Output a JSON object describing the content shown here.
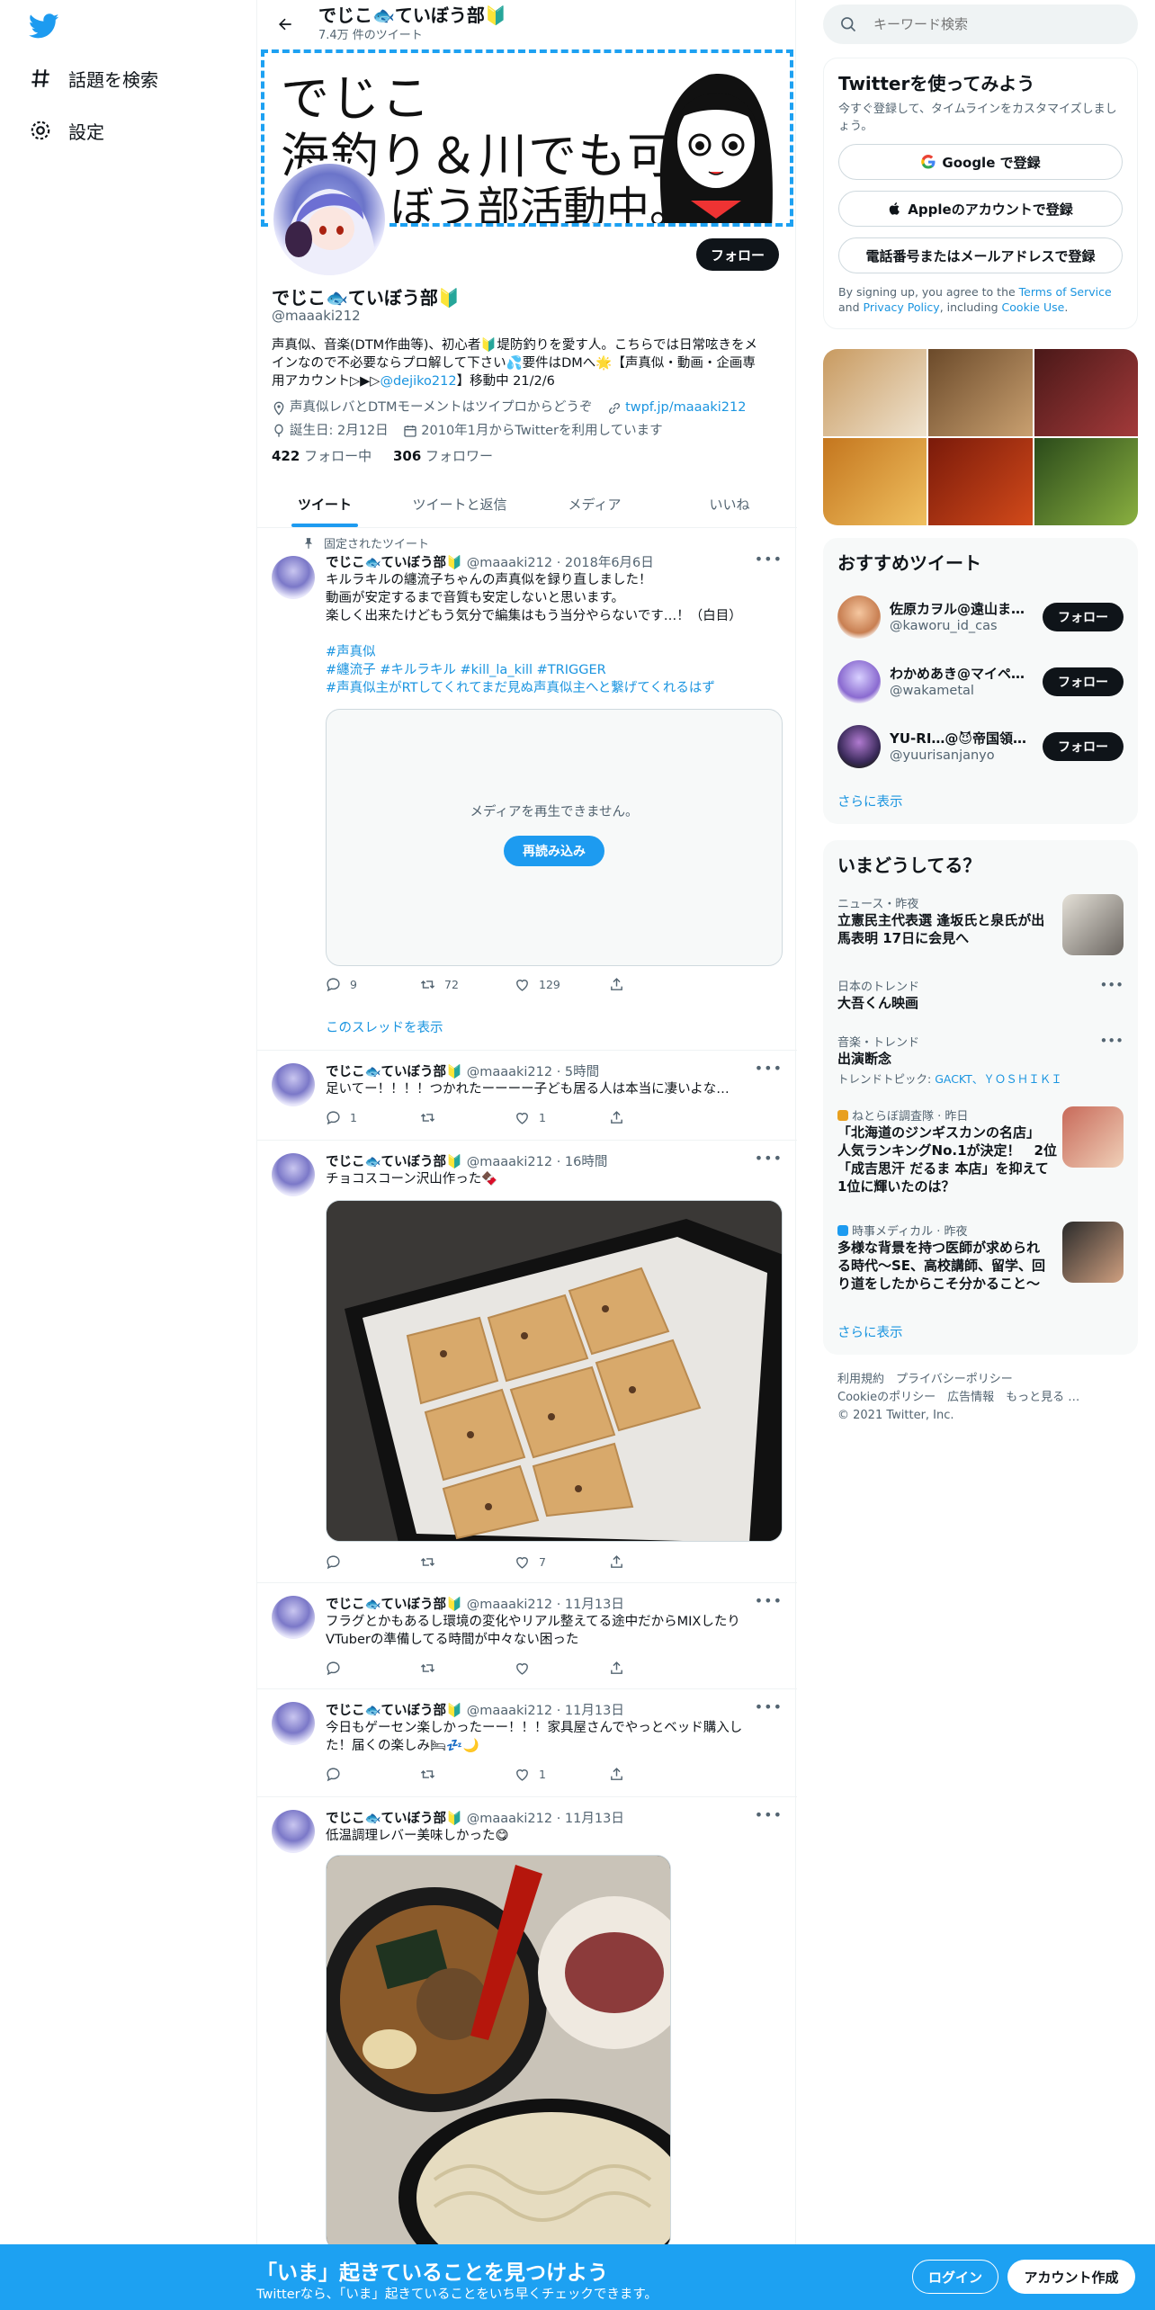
{
  "nav": {
    "explore_label": "話題を検索",
    "settings_label": "設定"
  },
  "header": {
    "name": "でじこ🐟ていぼう部🔰",
    "tweet_count": "7.4万 件のツイート"
  },
  "banner": {
    "line1": "でじこ",
    "line2": "海釣り＆川でも可",
    "line3": "ぼう部活動中。"
  },
  "profile": {
    "follow_label": "フォロー",
    "name": "でじこ🐟ていぼう部🔰",
    "handle": "@maaaki212",
    "bio1": "声真似、音楽(DTM作曲等)、初心者🔰堤防釣りを愛す人。こちらでは日常呟きをメ",
    "bio2": "インなので不必要ならプロ解して下さい💦要件はDMへ🌟【声真似・動画・企画専",
    "bio3_pre": "用アカウント▷▶▷",
    "bio3_link": "@dejiko212",
    "bio3_post": "】移動中 21/2/6",
    "location": "声真似レバとDTMモーメントはツイプロからどうぞ",
    "url": "twpf.jp/maaaki212",
    "birthday": "誕生日: 2月12日",
    "joined": "2010年1月からTwitterを利用しています",
    "following_count": "422",
    "following_label": "フォロー中",
    "followers_count": "306",
    "followers_label": "フォロワー"
  },
  "tabs": [
    "ツイート",
    "ツイートと返信",
    "メディア",
    "いいね"
  ],
  "pinned_label": "固定されたツイート",
  "tweets": [
    {
      "name": "でじこ🐟ていぼう部🔰",
      "meta": "@maaaki212 · 2018年6月6日",
      "lines": [
        "キルラキルの纏流子ちゃんの声真似を録り直しました！",
        "動画が安定するまで音質も安定しないと思います。",
        "楽しく出来たけどもう気分で編集はもう当分やらないです…！（白目）"
      ],
      "tags": [
        "#声真似",
        "#纏流子 #キルラキル #kill_la_kill #TRIGGER",
        "#声真似主がRTしてくれてまだ見ぬ声真似主へと繋げてくれるはず"
      ],
      "media_msg": "メディアを再生できません。",
      "reload": "再読み込み",
      "reply": "9",
      "rt": "72",
      "like": "129",
      "thread": "このスレッドを表示"
    },
    {
      "name": "でじこ🐟ていぼう部🔰",
      "meta": "@maaaki212 · 5時間",
      "text": "足いてー！！！！つかれたーーーー子ども居る人は本当に凄いよな…",
      "reply": "1",
      "rt": "",
      "like": "1"
    },
    {
      "name": "でじこ🐟ていぼう部🔰",
      "meta": "@maaaki212 · 16時間",
      "text": "チョコスコーン沢山作った🍫",
      "reply": "",
      "rt": "",
      "like": "7"
    },
    {
      "name": "でじこ🐟ていぼう部🔰",
      "meta": "@maaaki212 · 11月13日",
      "text": "フラグとかもあるし環境の変化やリアル整えてる途中だからMIXしたり",
      "text2": "VTuberの準備してる時間が中々ない困った",
      "reply": "",
      "rt": "",
      "like": ""
    },
    {
      "name": "でじこ🐟ていぼう部🔰",
      "meta": "@maaaki212 · 11月13日",
      "text": "今日もゲーセン楽しかったーー！！！家具屋さんでやっとベッド購入し",
      "text2": "た！届くの楽しみ🛏💤🌙",
      "reply": "",
      "rt": "",
      "like": "1"
    },
    {
      "name": "でじこ🐟ていぼう部🔰",
      "meta": "@maaaki212 · 11月13日",
      "text": "低温調理レバー美味しかった😋"
    }
  ],
  "search": {
    "placeholder": "キーワード検索"
  },
  "signup": {
    "title": "Twitterを使ってみよう",
    "sub": "今すぐ登録して、タイムラインをカスタマイズしましょう。",
    "google": "Google で登録",
    "apple": "Appleのアカウントで登録",
    "phone": "電話番号またはメールアドレスで登録",
    "terms_pre": "By signing up, you agree to the ",
    "terms_tos": "Terms of Service",
    "terms_and": " and ",
    "terms_pp": "Privacy Policy",
    "terms_inc": ", including ",
    "terms_cookie": "Cookie Use",
    "terms_end": "."
  },
  "wtf": {
    "title": "おすすめツイート",
    "users": [
      {
        "name": "佐原カヲル@遠山ま…",
        "handle": "@kaworu_id_cas",
        "btn": "フォロー"
      },
      {
        "name": "わかめあき@マイペ…",
        "handle": "@wakametal",
        "btn": "フォロー"
      },
      {
        "name": "YU-RI…@😈帝国領…",
        "handle": "@yuurisanjanyo",
        "btn": "フォロー"
      }
    ],
    "more": "さらに表示"
  },
  "trends": {
    "title": "いまどうしてる？",
    "items": [
      {
        "cat": "ニュース・昨夜",
        "title": "立憲民主代表選 逢坂氏と泉氏が出",
        "title2": "馬表明 17日に会見へ"
      },
      {
        "cat": "日本のトレンド",
        "title": "大吾くん映画"
      },
      {
        "cat": "音楽・トレンド",
        "title": "出演断念",
        "topic_label": "トレンドトピック: ",
        "topic": "GACKT、ＹＯＳＨＩＫＩ"
      },
      {
        "cat": "ねとらぼ調査隊 · 昨日",
        "title": "「北海道のジンギスカンの名店」",
        "title2": "人気ランキングNo.1が決定！　2位",
        "title3": "「成吉思汗 だるま 本店」を抑えて",
        "title4": "1位に輝いたのは？"
      },
      {
        "cat": "時事メディカル · 昨夜",
        "title": "多様な背景を持つ医師が求められ",
        "title2": "る時代～SE、高校講師、留学、回",
        "title3": "り道をしたからこそ分かること～"
      }
    ],
    "more": "さらに表示"
  },
  "footer": {
    "l1": "利用規約　プライバシーポリシー",
    "l2": "Cookieのポリシー　広告情報　もっと見る …",
    "l3": "© 2021 Twitter, Inc."
  },
  "bottom": {
    "title": "「いま」起きていることを見つけよう",
    "sub": "Twitterなら、「いま」起きていることをいち早くチェックできます。",
    "login": "ログイン",
    "signup": "アカウント作成"
  },
  "colors": {
    "accent": "#1d9bf0",
    "bottom_bar": "#1da1f2",
    "text": "#0f1419",
    "muted": "#536471"
  }
}
